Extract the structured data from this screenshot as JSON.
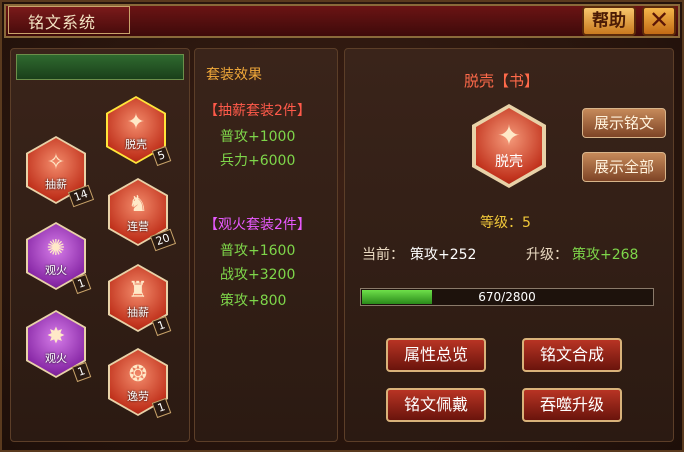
{
  "header": {
    "title": "铭文系统",
    "help_label": "帮助",
    "close_label": "✕"
  },
  "slots": [
    {
      "name": "抽薪",
      "count": "14",
      "color": "red",
      "glyph": "✧"
    },
    {
      "name": "脱壳",
      "count": "5",
      "color": "red",
      "glyph": "✦"
    },
    {
      "name": "连营",
      "count": "20",
      "color": "red",
      "glyph": "♞"
    },
    {
      "name": "观火",
      "count": "1",
      "color": "purple",
      "glyph": "✺"
    },
    {
      "name": "抽薪",
      "count": "1",
      "color": "red",
      "glyph": "♜"
    },
    {
      "name": "观火",
      "count": "1",
      "color": "purple",
      "glyph": "✸"
    },
    {
      "name": "逸劳",
      "count": "1",
      "color": "red",
      "glyph": "❂"
    }
  ],
  "set_effects": {
    "title": "套装效果",
    "groups": [
      {
        "name": "【抽薪套装2件】",
        "color": "#ff5a4a",
        "stats": [
          "普攻+1000",
          "兵力+6000"
        ]
      },
      {
        "name": "【观火套装2件】",
        "color": "#e85aff",
        "stats": [
          "普攻+1600",
          "战攻+3200",
          "策攻+800"
        ]
      }
    ]
  },
  "detail": {
    "name": "脱壳【书】",
    "icon_label": "脱壳",
    "level_text": "等级：5",
    "current_label": "当前：",
    "current_value": "策攻+252",
    "upgrade_label": "升级：",
    "upgrade_value": "策攻+268",
    "progress_text": "670/2800",
    "progress_fraction": 0.2393,
    "show_inscription": "展示铭文",
    "show_all": "展示全部"
  },
  "actions": {
    "attr_overview": "属性总览",
    "compose": "铭文合成",
    "equip": "铭文佩戴",
    "devour": "吞噬升级"
  }
}
